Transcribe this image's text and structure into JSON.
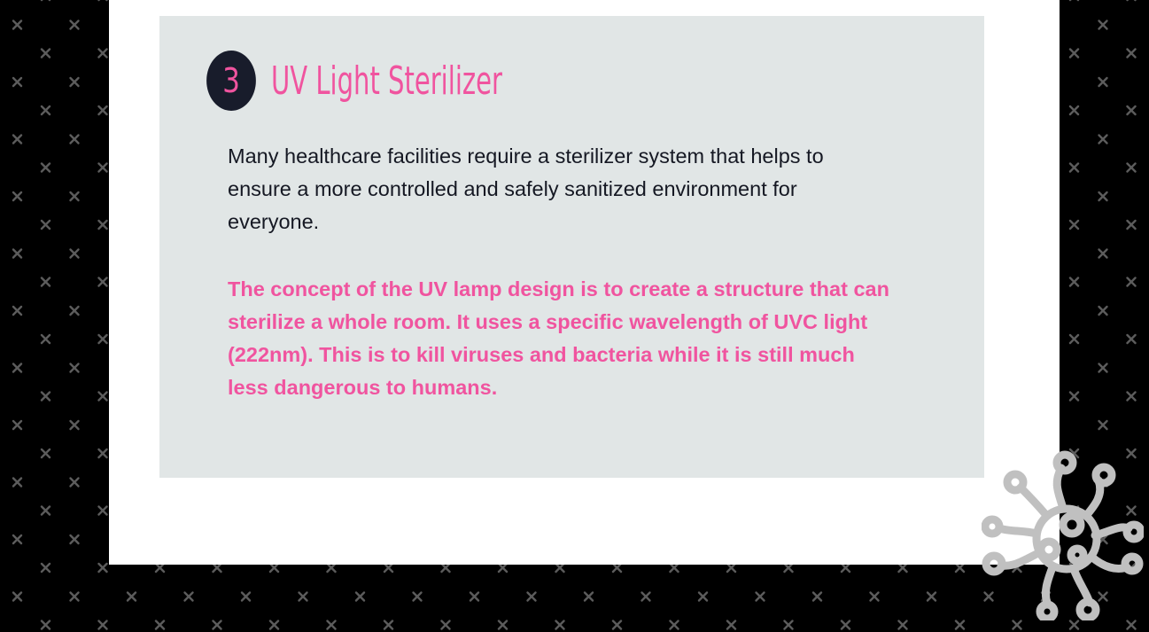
{
  "section": {
    "step_number": "3",
    "title": "UV Light Sterilizer",
    "intro_text": "Many healthcare facilities require a sterilizer system that helps to ensure a more controlled and safely sanitized environment for everyone.",
    "highlight_text": "The concept of the UV lamp design is to create a structure that can sterilize a whole room. It uses a specific wavelength of UVC light (222nm). This is to kill viruses and bacteria while it is still much less dangerous to humans."
  },
  "colors": {
    "background": "#000000",
    "card": "#ffffff",
    "panel": "#e1e6e6",
    "accent_pink": "#f0549f",
    "badge_dark": "#181c2b",
    "body_text": "#151823",
    "pattern": "#5a5a5a",
    "virus_outline": "#c0c0c0"
  },
  "icons": {
    "background_pattern": "x-cross-pattern",
    "decoration": "virus-icon"
  }
}
